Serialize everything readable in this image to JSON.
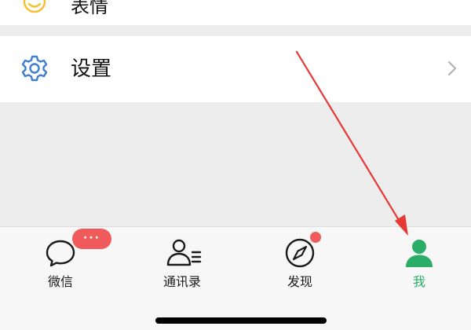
{
  "top_row": {
    "label": "表情",
    "icon": "smile-icon",
    "icon_color": "#f5c132"
  },
  "settings_row": {
    "label": "设置",
    "icon": "gear-icon",
    "icon_color": "#3d7ed6"
  },
  "tabbar": {
    "tabs": [
      {
        "label": "微信",
        "icon": "chat-bubble-icon",
        "active": false,
        "badge": "···"
      },
      {
        "label": "通讯录",
        "icon": "contacts-icon",
        "active": false
      },
      {
        "label": "发现",
        "icon": "compass-icon",
        "active": false,
        "badge_dot": true
      },
      {
        "label": "我",
        "icon": "person-icon",
        "active": true
      }
    ]
  },
  "colors": {
    "accent_active": "#2aae67",
    "badge": "#f05a5a",
    "annotation_arrow": "#e53935"
  }
}
